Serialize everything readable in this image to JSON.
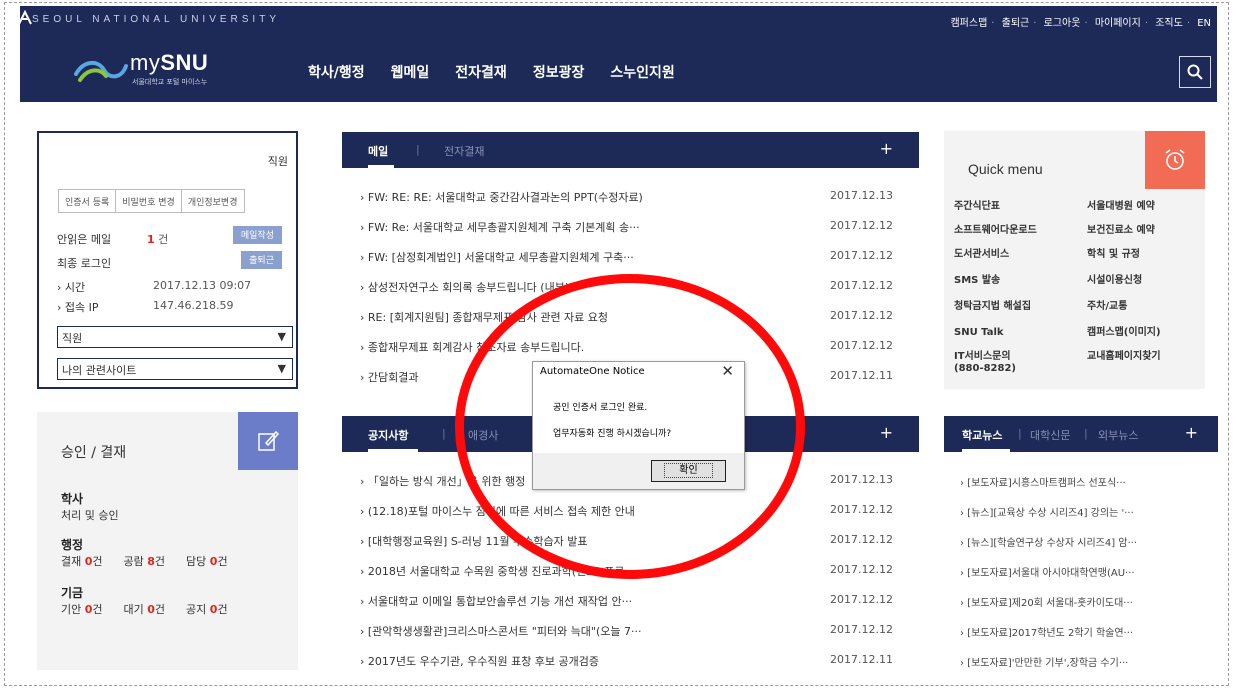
{
  "header": {
    "univ_name": "SEOUL NATIONAL UNIVERSITY",
    "brand_my": "my",
    "brand_snu": "SNU",
    "brand_sub": "서울대학교 포털 마이스누",
    "util_links": [
      "캠퍼스맵",
      "출퇴근",
      "로그아웃",
      "마이페이지",
      "조직도",
      "EN"
    ],
    "nav": [
      "학사/행정",
      "웹메일",
      "전자결재",
      "정보광장",
      "스누인지원"
    ]
  },
  "login": {
    "role_label": "직원",
    "buttons": [
      "인증서 등록",
      "비밀번호 변경",
      "개인정보변경"
    ],
    "unread_label": "안읽은 메일",
    "unread_count": "1",
    "unread_unit": "건",
    "compose_btn": "메일작성",
    "last_login_label": "최종 로그인",
    "commute_btn": "출퇴근",
    "time_label": "시간",
    "time_value": "2017.12.13 09:07",
    "ip_label": "접속 IP",
    "ip_value": "147.46.218.59",
    "select1": "직원",
    "select2": "나의 관련사이트"
  },
  "approval": {
    "title": "승인 / 결재",
    "academic_title": "학사",
    "academic_sub": "처리 및 승인",
    "admin_title": "행정",
    "admin_items": [
      {
        "label": "결재",
        "count": "0",
        "unit": "건"
      },
      {
        "label": "공람",
        "count": "8",
        "unit": "건"
      },
      {
        "label": "담당",
        "count": "0",
        "unit": "건"
      }
    ],
    "plan_title": "기금",
    "plan_items": [
      {
        "label": "기안",
        "count": "0",
        "unit": "건"
      },
      {
        "label": "대기",
        "count": "0",
        "unit": "건"
      },
      {
        "label": "공지",
        "count": "0",
        "unit": "건"
      }
    ]
  },
  "mail": {
    "tabs": [
      "메일",
      "전자결재"
    ],
    "plus": "+",
    "items": [
      {
        "title": "› FW: RE: RE: 서울대학교 중간감사결과논의 PPT(수정자료)",
        "date": "2017.12.13"
      },
      {
        "title": "› FW: Re: 서울대학교 세무총괄지원체계 구축 기본계획 송···",
        "date": "2017.12.12"
      },
      {
        "title": "› FW: [삼정회계법인] 서울대학교 세무총괄지원체계 구축···",
        "date": "2017.12.12"
      },
      {
        "title": "› 삼성전자연구소 회의록 송부드립니다 (내부)",
        "date": "2017.12.12"
      },
      {
        "title": "› RE: [회계지원팀] 종합재무제표 감사 관련 자료 요청",
        "date": "2017.12.12"
      },
      {
        "title": "› 종합재무제표 회계감사 참조자료 송부드립니다.",
        "date": "2017.12.12"
      },
      {
        "title": "› 간담회결과",
        "date": "2017.12.11"
      }
    ]
  },
  "notice": {
    "tabs": [
      "공지사항",
      "애경사"
    ],
    "plus": "+",
    "items": [
      {
        "title": "› 「일하는 방식 개선」을 위한 행정",
        "date": "2017.12.13"
      },
      {
        "title": "› (12.18)포털 마이스누 점검에 따른 서비스 접속 제한 안내",
        "date": "2017.12.12"
      },
      {
        "title": "› [대학행정교육원] S-러닝 11월 우수학습자 발표",
        "date": "2017.12.12"
      },
      {
        "title": "› 2018년 서울대학교 수목원 중학생 진로과학(진로) 프로",
        "date": "2017.12.12"
      },
      {
        "title": "› 서울대학교 이메일 통합보안솔루션 기능 개선 재작업 안···",
        "date": "2017.12.12"
      },
      {
        "title": "› [관악학생생활관]크리스마스콘서트 \"피터와 늑대\"(오늘 7···",
        "date": "2017.12.12"
      },
      {
        "title": "› 2017년도 우수기관, 우수직원 표창 후보 공개검증",
        "date": "2017.12.11"
      }
    ]
  },
  "quick": {
    "title": "Quick menu",
    "left": [
      "주간식단표",
      "소프트웨어다운로드",
      "도서관서비스",
      "SMS 발송",
      "청탁금지법 해설집",
      "SNU Talk",
      "IT서비스문의",
      "(880-8282)"
    ],
    "right": [
      "서울대병원 예약",
      "보건진료소 예약",
      "학칙 및 규정",
      "시설이용신청",
      "주차/교통",
      "캠퍼스맵(이미지)",
      "교내홈페이지찾기"
    ]
  },
  "news": {
    "tabs": [
      "학교뉴스",
      "대학신문",
      "외부뉴스"
    ],
    "plus": "+",
    "items": [
      "› [보도자료]시흥스마트캠퍼스 선포식···",
      "› [뉴스][교육상 수상 시리즈4] 강의는 '···",
      "› [뉴스][학술연구상 수상자 시리즈4] 암···",
      "› [보도자료]서울대 아시아대학연맹(AU···",
      "› [보도자료]제20회 서울대-홋카이도대···",
      "› [보도자료]2017학년도 2학기 학술연···",
      "› [보도자료]'만만한 기부',장학금 수기···"
    ]
  },
  "dialog": {
    "title": "AutomateOne Notice",
    "close": "✕",
    "line1": "공인 인증서 로그인 완료.",
    "line2": "업무자동화 진행 하시겠습니까?",
    "ok": "확인"
  },
  "colors": {
    "navy": "#1d2a57",
    "annotation_red": "#ff0a0a",
    "accent_red": "#e0261a"
  }
}
